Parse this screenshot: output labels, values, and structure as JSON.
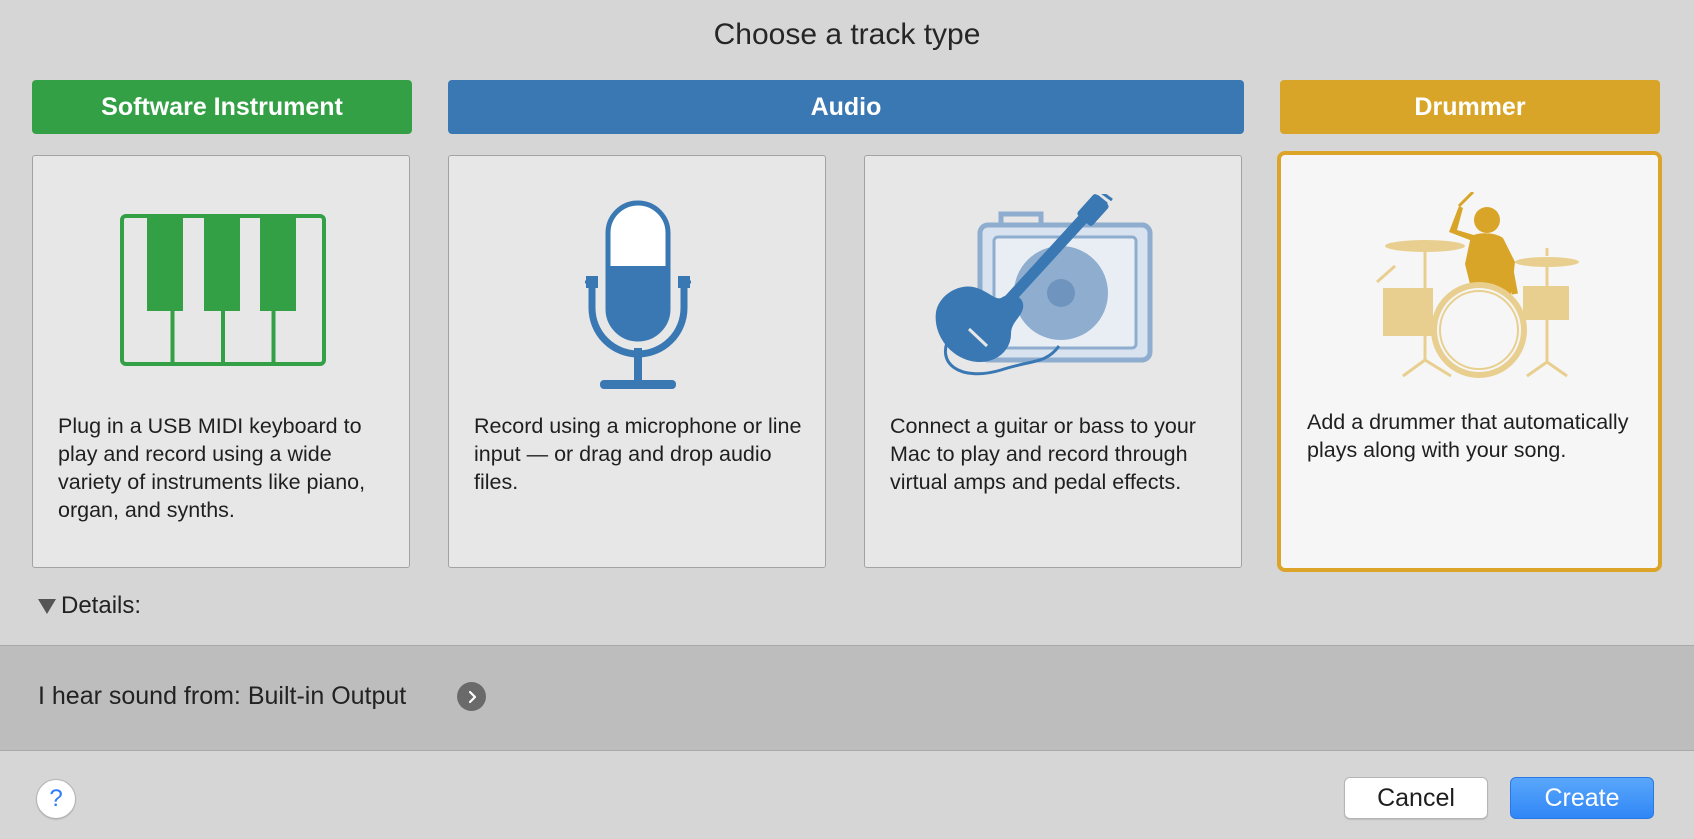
{
  "dialog": {
    "title": "Choose a track type"
  },
  "categories": [
    {
      "label": "Software Instrument",
      "color": "#34a046"
    },
    {
      "label": "Audio",
      "color": "#3a78b3"
    },
    {
      "label": "Drummer",
      "color": "#d9a528"
    }
  ],
  "cards": [
    {
      "icon": "piano-keyboard-icon",
      "description": "Plug in a USB MIDI keyboard to play and record using a wide variety of instruments like piano, organ, and synths.",
      "selected": false
    },
    {
      "icon": "microphone-icon",
      "description": "Record using a microphone or line input — or drag and drop audio files.",
      "selected": false
    },
    {
      "icon": "guitar-amp-icon",
      "description": "Connect a guitar or bass to your Mac to play and record through virtual amps and pedal effects.",
      "selected": false
    },
    {
      "icon": "drummer-icon",
      "description": "Add a drummer that automatically plays along with your song.",
      "selected": true
    }
  ],
  "details": {
    "label": "Details:",
    "expanded": true
  },
  "output": {
    "label": "I hear sound from: Built-in Output"
  },
  "footer": {
    "help_label": "?",
    "cancel_label": "Cancel",
    "create_label": "Create"
  },
  "colors": {
    "background": "#d6d6d6",
    "selection": "#dca529",
    "accent_blue": "#2f86f6"
  }
}
